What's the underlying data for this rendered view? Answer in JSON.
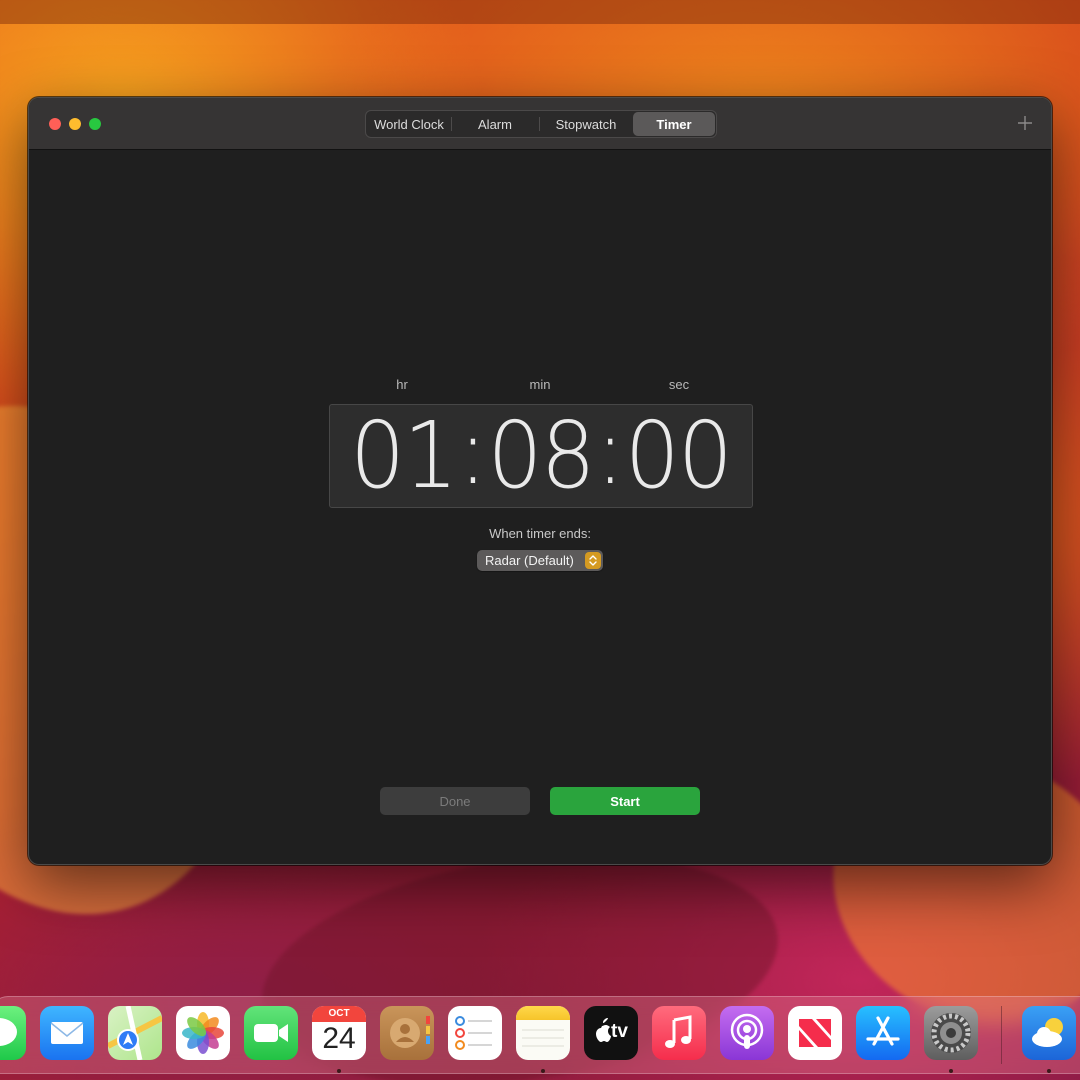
{
  "window": {
    "tabs": [
      {
        "label": "World Clock",
        "active": false
      },
      {
        "label": "Alarm",
        "active": false
      },
      {
        "label": "Stopwatch",
        "active": false
      },
      {
        "label": "Timer",
        "active": true
      }
    ],
    "add_icon": "plus-icon"
  },
  "timer": {
    "units": {
      "hr": "hr",
      "min": "min",
      "sec": "sec"
    },
    "hours": "01",
    "minutes": "08",
    "seconds": "00",
    "separator": ":",
    "ends_label": "When timer ends:",
    "sound": "Radar (Default)"
  },
  "buttons": {
    "done": "Done",
    "start": "Start"
  },
  "colors": {
    "accent_green": "#2aa43d",
    "select_arrows": "#d49a22",
    "close": "#ff5f57",
    "minimize": "#febc2e",
    "zoom": "#28c840"
  },
  "dock": {
    "calendar": {
      "month": "OCT",
      "day": "24"
    },
    "tv_label": "tv",
    "apps": [
      "messages-icon",
      "mail-icon",
      "maps-icon",
      "photos-icon",
      "facetime-icon",
      "calendar-icon",
      "contacts-icon",
      "reminders-icon",
      "notes-icon",
      "apple-tv-icon",
      "music-icon",
      "podcasts-icon",
      "news-icon",
      "app-store-icon",
      "system-settings-icon",
      "weather-icon"
    ]
  }
}
